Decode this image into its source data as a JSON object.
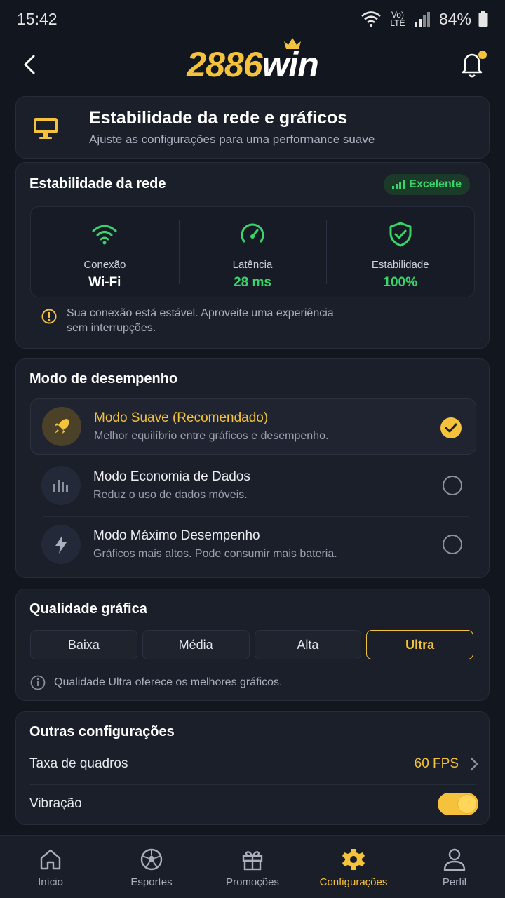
{
  "status_bar": {
    "time": "15:42",
    "network_label": "Vo) LTE",
    "battery": "84%"
  },
  "app_bar": {
    "logo_number": "2886",
    "logo_word": "win"
  },
  "header": {
    "title": "Estabilidade da rede e gráficos",
    "subtitle": "Ajuste as configurações para uma performance suave"
  },
  "network": {
    "title": "Estabilidade da rede",
    "badge": "Excelente",
    "stats": [
      {
        "label": "Conexão",
        "value": "Wi-Fi"
      },
      {
        "label": "Latência",
        "value": "28 ms"
      },
      {
        "label": "Estabilidade",
        "value": "100%"
      }
    ],
    "note": "Sua conexão está estável. Aproveite uma experiência sem interrupções."
  },
  "performance": {
    "title": "Modo de desempenho",
    "modes": [
      {
        "title": "Modo Suave (Recomendado)",
        "desc": "Melhor equilíbrio entre gráficos e desempenho.",
        "selected": true
      },
      {
        "title": "Modo Economia de Dados",
        "desc": "Reduz o uso de dados móveis.",
        "selected": false
      },
      {
        "title": "Modo Máximo Desempenho",
        "desc": "Gráficos mais altos. Pode consumir mais bateria.",
        "selected": false
      }
    ]
  },
  "quality": {
    "title": "Qualidade gráfica",
    "options": [
      "Baixa",
      "Média",
      "Alta",
      "Ultra"
    ],
    "selected": "Ultra",
    "note": "Qualidade Ultra oferece os melhores gráficos."
  },
  "other": {
    "title": "Outras configurações",
    "frame_rate_label": "Taxa de quadros",
    "frame_rate_value": "60 FPS",
    "vibration_label": "Vibração",
    "vibration_on": true
  },
  "bottom_nav": {
    "items": [
      {
        "label": "Início",
        "icon": "home-icon"
      },
      {
        "label": "Esportes",
        "icon": "soccer-ball-icon"
      },
      {
        "label": "Promoções",
        "icon": "gift-icon"
      },
      {
        "label": "Configurações",
        "icon": "gear-icon"
      },
      {
        "label": "Perfil",
        "icon": "user-icon"
      }
    ],
    "active_index": 3
  },
  "colors": {
    "accent": "#f5c33b",
    "success": "#39d46a",
    "background": "#12161f",
    "card": "#1a1f2a"
  }
}
